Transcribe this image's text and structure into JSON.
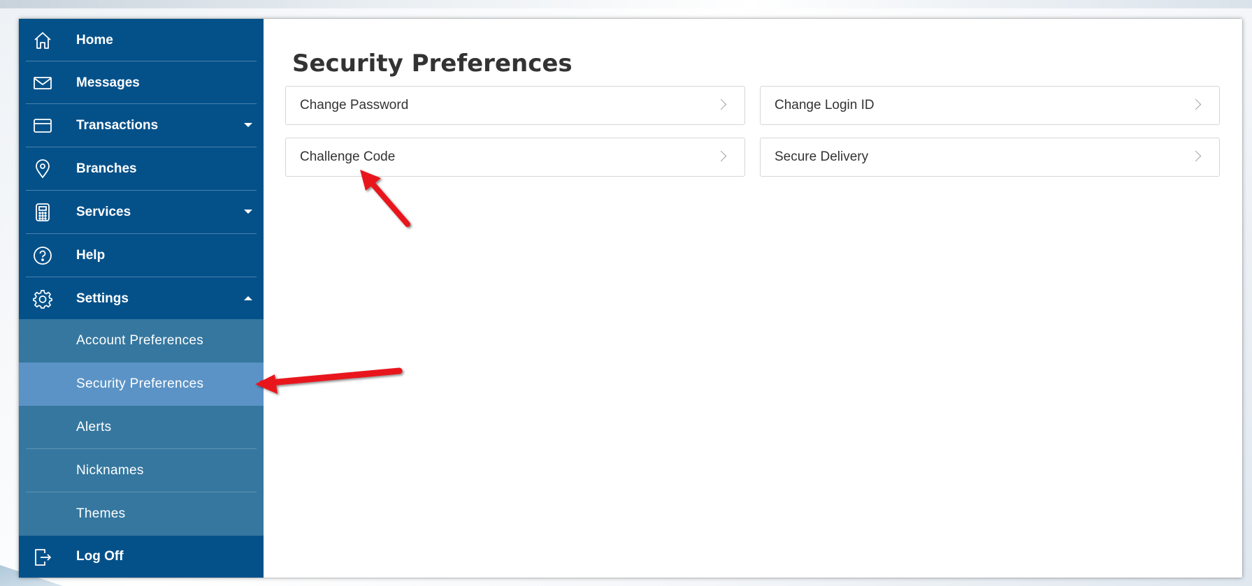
{
  "sidebar": {
    "items": [
      {
        "label": "Home",
        "icon": "home-icon"
      },
      {
        "label": "Messages",
        "icon": "envelope-icon"
      },
      {
        "label": "Transactions",
        "icon": "credit-card-icon"
      },
      {
        "label": "Branches",
        "icon": "location-pin-icon"
      },
      {
        "label": "Services",
        "icon": "calculator-icon"
      },
      {
        "label": "Help",
        "icon": "help-icon"
      },
      {
        "label": "Settings",
        "icon": "gear-icon"
      }
    ],
    "settings_submenu": [
      {
        "label": "Account Preferences"
      },
      {
        "label": "Security Preferences",
        "active": true
      },
      {
        "label": "Alerts"
      },
      {
        "label": "Nicknames"
      },
      {
        "label": "Themes"
      }
    ],
    "logoff": {
      "label": "Log Off",
      "icon": "logout-icon"
    }
  },
  "main": {
    "title": "Security Preferences",
    "cards": [
      {
        "label": "Change Password"
      },
      {
        "label": "Change Login ID"
      },
      {
        "label": "Challenge Code"
      },
      {
        "label": "Secure Delivery"
      }
    ]
  },
  "colors": {
    "sidebar": "#04518a",
    "submenu": "#35779f",
    "submenu_active": "#5b93c6",
    "annotation_arrow": "#e8141b"
  }
}
